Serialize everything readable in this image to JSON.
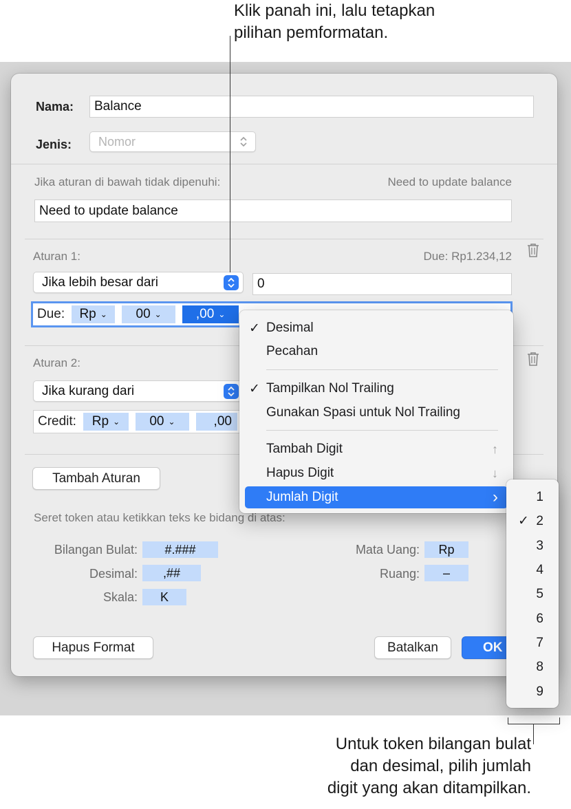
{
  "callouts": {
    "top_line1": "Klik panah ini, lalu tetapkan",
    "top_line2": "pilihan pemformatan.",
    "bottom_line1": "Untuk token bilangan bulat",
    "bottom_line2": "dan desimal, pilih jumlah",
    "bottom_line3": "digit yang akan ditampilkan."
  },
  "dialog": {
    "name_label": "Nama:",
    "name_value": "Balance",
    "type_label": "Jenis:",
    "type_value": "Nomor",
    "fallback_label": "Jika aturan di bawah tidak dipenuhi:",
    "fallback_preview": "Need to update balance",
    "fallback_value": "Need to update balance",
    "rule1": {
      "title": "Aturan 1:",
      "preview": "Due: Rp1.234,12",
      "condition": "Jika lebih besar dari",
      "value": "0",
      "text_label": "Due:",
      "tokens": [
        "Rp",
        "00",
        ",00"
      ]
    },
    "rule2": {
      "title": "Aturan 2:",
      "condition": "Jika kurang dari",
      "text_label": "Credit:",
      "tokens": [
        "Rp",
        "00",
        ",00"
      ]
    },
    "add_rule_button": "Tambah Aturan",
    "palette_hint": "Seret token atau ketikkan teks ke bidang di atas:",
    "palette": {
      "integer_label": "Bilangan Bulat:",
      "integer_token": "#.###",
      "decimal_label": "Desimal:",
      "decimal_token": ",##",
      "scale_label": "Skala:",
      "scale_token": "K",
      "currency_label": "Mata Uang:",
      "currency_token": "Rp",
      "space_label": "Ruang:",
      "space_token": "–"
    },
    "clear_button": "Hapus Format",
    "cancel_button": "Batalkan",
    "ok_button": "OK"
  },
  "menu": {
    "decimal": "Desimal",
    "fraction": "Pecahan",
    "show_trailing": "Tampilkan Nol Trailing",
    "use_space": "Gunakan Spasi untuk Nol Trailing",
    "add_digit": "Tambah Digit",
    "add_digit_key": "↑",
    "remove_digit": "Hapus Digit",
    "remove_digit_key": "↓",
    "digit_count": "Jumlah Digit",
    "submenu_arrow": "›"
  },
  "submenu": {
    "options": [
      "1",
      "2",
      "3",
      "4",
      "5",
      "6",
      "7",
      "8",
      "9"
    ],
    "selected": "2"
  },
  "colors": {
    "accent": "#2f7cf6",
    "token": "#c4dbfb",
    "dialog_bg": "#ececec"
  }
}
